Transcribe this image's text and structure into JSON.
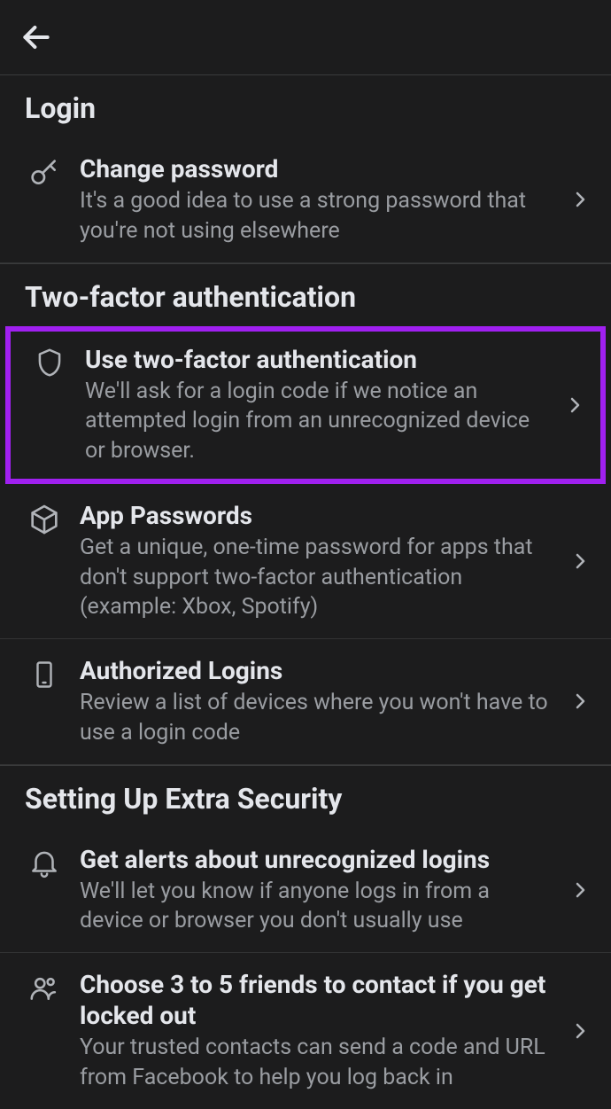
{
  "sections": [
    {
      "header": "Login",
      "items": [
        {
          "title": "Change password",
          "desc": "It's a good idea to use a strong password that you're not using elsewhere"
        }
      ]
    },
    {
      "header": "Two-factor authentication",
      "items": [
        {
          "title": "Use two-factor authentication",
          "desc": "We'll ask for a login code if we notice an attempted login from an unrecognized device or browser."
        },
        {
          "title": "App Passwords",
          "desc": "Get a unique, one-time password for apps that don't support two-factor authentication (example: Xbox, Spotify)"
        },
        {
          "title": "Authorized Logins",
          "desc": "Review a list of devices where you won't have to use a login code"
        }
      ]
    },
    {
      "header": "Setting Up Extra Security",
      "items": [
        {
          "title": "Get alerts about unrecognized logins",
          "desc": "We'll let you know if anyone logs in from a device or browser you don't usually use"
        },
        {
          "title": "Choose 3 to 5 friends to contact if you get locked out",
          "desc": "Your trusted contacts can send a code and URL from Facebook to help you log back in"
        }
      ]
    }
  ]
}
